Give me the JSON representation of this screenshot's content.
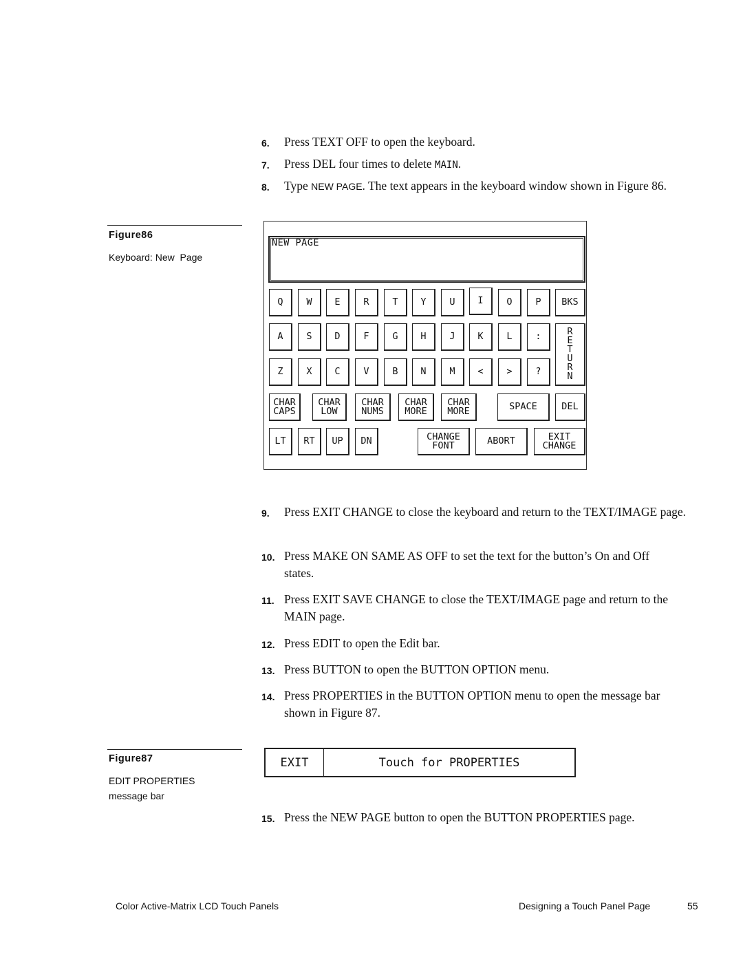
{
  "steps": [
    {
      "num": "6.",
      "parts": [
        "Press TEXT OFF to open the keyboard."
      ]
    },
    {
      "num": "7.",
      "pre": "Press DEL four times to delete ",
      "mono": "MAIN",
      "post": "."
    },
    {
      "num": "8.",
      "pre": "Type ",
      "sans": "NEW PAGE",
      "post": ". The text appears in the keyboard window shown in Figure 86."
    },
    {
      "num": "9.",
      "text": "Press EXIT CHANGE to close the keyboard and return to the TEXT/IMAGE page."
    },
    {
      "num": "10.",
      "text": "Press MAKE ON SAME AS OFF to set the text for the button’s On and Off states."
    },
    {
      "num": "11.",
      "text": "Press EXIT SAVE CHANGE to close the TEXT/IMAGE page and return to the MAIN page."
    },
    {
      "num": "12.",
      "text": "Press EDIT to open the Edit bar."
    },
    {
      "num": "13.",
      "text": "Press BUTTON to open the BUTTON OPTION menu."
    },
    {
      "num": "14.",
      "text": "Press PROPERTIES in the BUTTON OPTION menu to open the message bar shown in Figure 87."
    },
    {
      "num": "15.",
      "text": "Press the NEW PAGE button to open the BUTTON PROPERTIES page."
    }
  ],
  "figure86": {
    "title": "Figure86",
    "caption": "Keyboard: New  Page",
    "display_text": "NEW PAGE",
    "keys": {
      "row1": [
        "Q",
        "W",
        "E",
        "R",
        "T",
        "Y",
        "U",
        "I",
        "O",
        "P",
        "BKS"
      ],
      "row2": [
        "A",
        "S",
        "D",
        "F",
        "G",
        "H",
        "J",
        "K",
        "L",
        ":"
      ],
      "row3": [
        "Z",
        "X",
        "C",
        "V",
        "B",
        "N",
        "M",
        "<",
        ">",
        "?"
      ],
      "return": "R\nE\nT\nU\nR\nN",
      "row4": [
        "CHAR\nCAPS",
        "CHAR\nLOW",
        "CHAR\nNUMS",
        "CHAR\nMORE",
        "CHAR\nMORE",
        "SPACE",
        "DEL"
      ],
      "row5": [
        "LT",
        "RT",
        "UP",
        "DN",
        "CHANGE\nFONT",
        "ABORT",
        "EXIT\nCHANGE"
      ]
    }
  },
  "figure87": {
    "title": "Figure87",
    "caption_line1": "EDIT PROPERTIES",
    "caption_line2": "message bar",
    "exit_label": "EXIT",
    "message": "Touch for PROPERTIES"
  },
  "footer": {
    "left": "Color Active-Matrix LCD Touch Panels",
    "section": "Designing a Touch Panel Page",
    "page": "55"
  }
}
